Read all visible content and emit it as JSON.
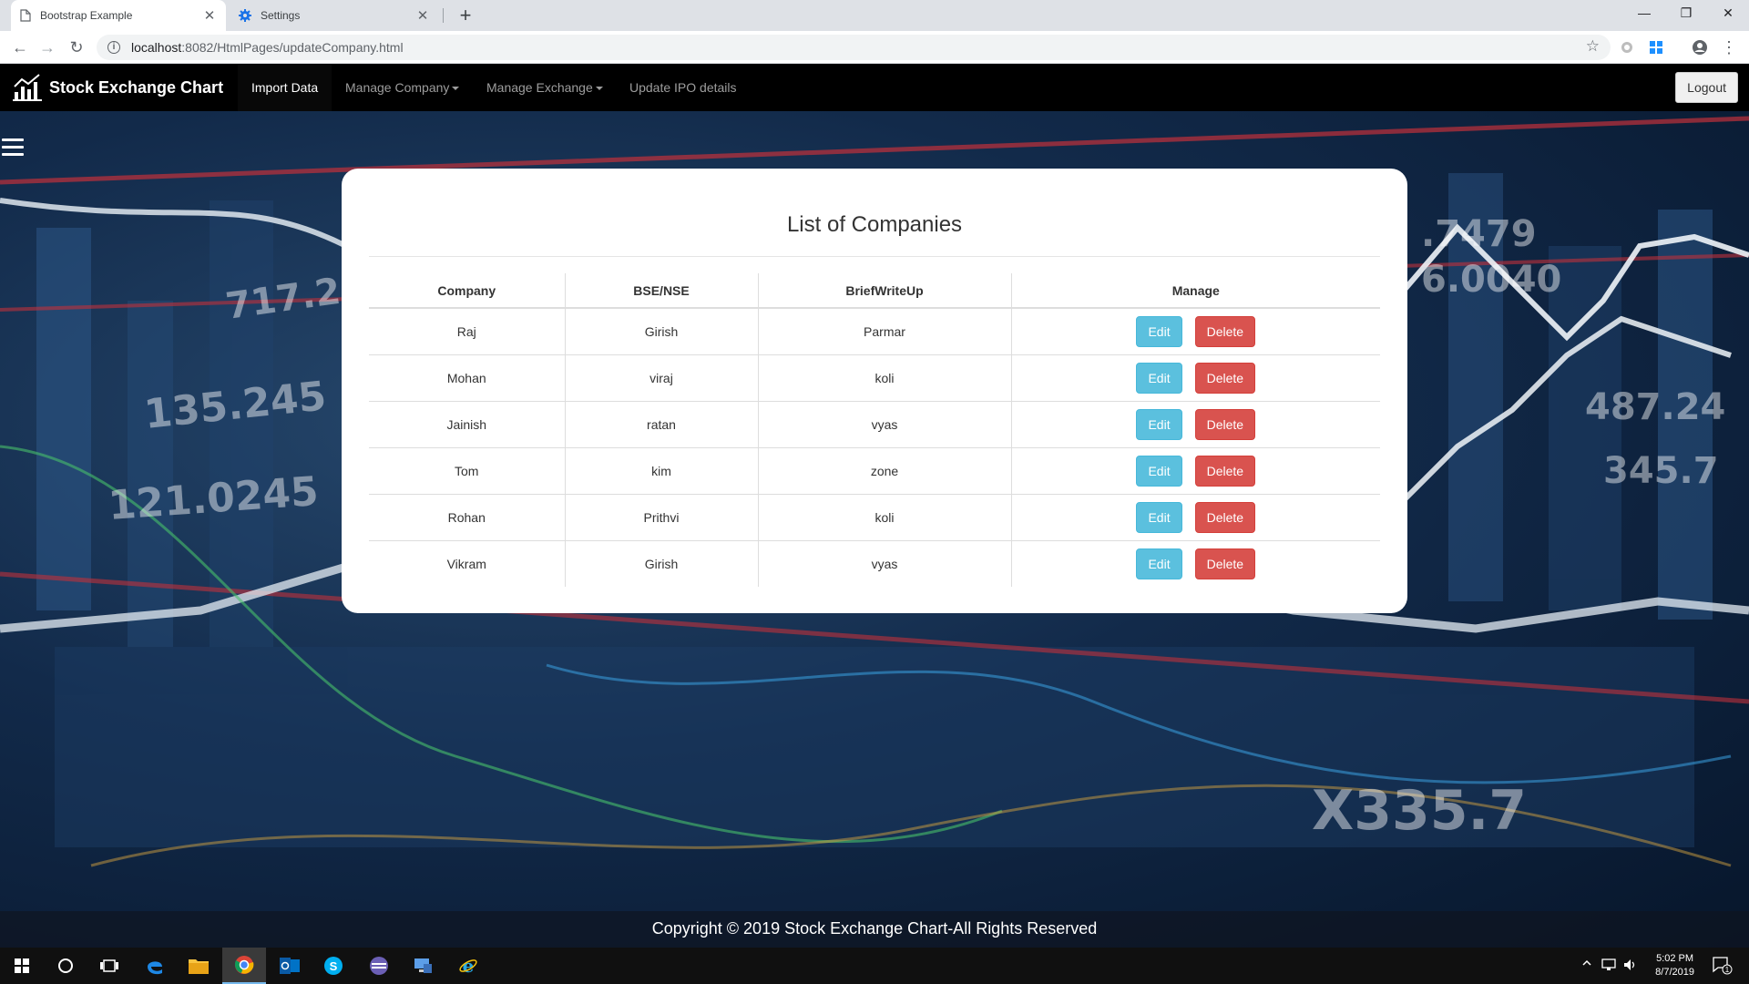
{
  "browser": {
    "tabs": [
      {
        "title": "Bootstrap Example",
        "icon": "page-icon",
        "active": true
      },
      {
        "title": "Settings",
        "icon": "gear-icon",
        "active": false
      }
    ],
    "url_host": "localhost",
    "url_rest": ":8082/HtmlPages/updateCompany.html"
  },
  "nav": {
    "brand": "Stock Exchange Chart",
    "links": [
      "Import Data",
      "Manage Company",
      "Manage Exchange",
      "Update IPO details"
    ],
    "logout": "Logout"
  },
  "card": {
    "title": "List of Companies",
    "headers": [
      "Company",
      "BSE/NSE",
      "BriefWriteUp",
      "Manage"
    ],
    "edit_label": "Edit",
    "delete_label": "Delete",
    "rows": [
      [
        "Raj",
        "Girish",
        "Parmar"
      ],
      [
        "Mohan",
        "viraj",
        "koli"
      ],
      [
        "Jainish",
        "ratan",
        "vyas"
      ],
      [
        "Tom",
        "kim",
        "zone"
      ],
      [
        "Rohan",
        "Prithvi",
        "koli"
      ],
      [
        "Vikram",
        "Girish",
        "vyas"
      ]
    ]
  },
  "footer": {
    "text": "Copyright © 2019 Stock Exchange Chart-All Rights Reserved"
  },
  "taskbar": {
    "time": "5:02 PM",
    "date": "8/7/2019",
    "notifications": "1"
  },
  "colors": {
    "edit": "#5bc0de",
    "delete": "#d9534f",
    "navbar": "#000000"
  }
}
